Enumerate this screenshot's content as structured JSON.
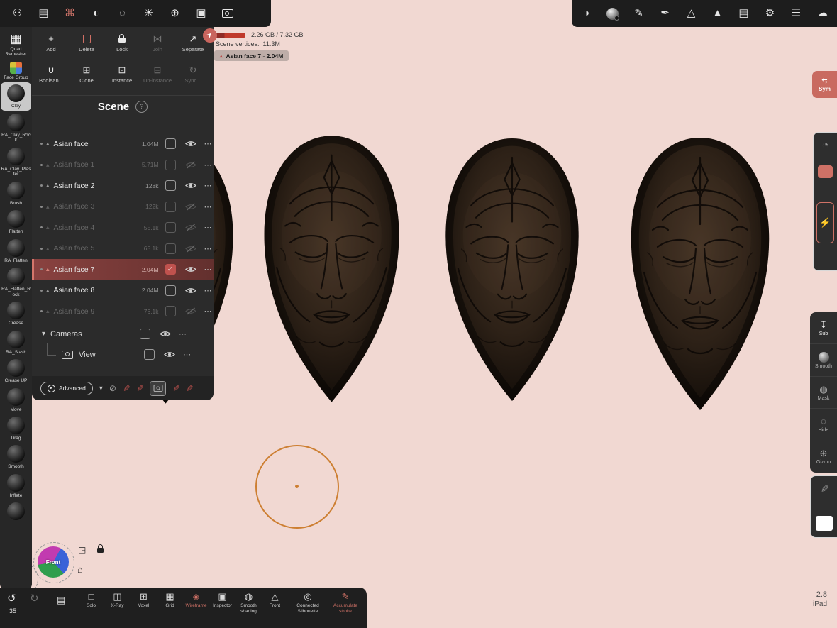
{
  "app": {
    "undo_count": "35",
    "version": "2.8",
    "device": "iPad"
  },
  "memory": {
    "usage": "2.26 GB / 7.32 GB",
    "vertices_label": "Scene vertices:",
    "vertices_value": "11.3M",
    "selected_chip": "Asian face 7 - 2.04M"
  },
  "glyphs": {
    "dots": "⋯",
    "triangle": "▴",
    "chevron": "▾",
    "help": "?",
    "undo": "↺",
    "redo": "↻",
    "list": "▤",
    "pin": "➤",
    "plus": "+",
    "join": "⋈",
    "separate": "↗",
    "boolean": "∪",
    "clone": "⊞",
    "instance": "⊡",
    "uninstance": "⊟",
    "sync": "↻",
    "adv_circle": "⊘",
    "brush": "✎",
    "dial": "◔",
    "bolt": "⚡",
    "sym": "⇆",
    "home": "⌂",
    "expand": "◳"
  },
  "top_toolbar": {
    "left_icons": [
      {
        "name": "users",
        "glyph": "⚇"
      },
      {
        "name": "files",
        "glyph": "▤"
      },
      {
        "name": "scene-graph",
        "glyph": "⌘"
      },
      {
        "name": "boolean",
        "glyph": "◐"
      },
      {
        "name": "topology",
        "glyph": "◌"
      },
      {
        "name": "lighting",
        "glyph": "☀"
      },
      {
        "name": "environment",
        "glyph": "⊕"
      },
      {
        "name": "image",
        "glyph": "▣"
      }
    ],
    "right_icons": [
      {
        "name": "paint",
        "glyph": "◑"
      },
      {
        "name": "pencil",
        "glyph": "✎"
      },
      {
        "name": "stamp",
        "glyph": "✒"
      },
      {
        "name": "falloff",
        "glyph": "△"
      },
      {
        "name": "alpha",
        "glyph": "▲"
      },
      {
        "name": "layers",
        "glyph": "▤"
      },
      {
        "name": "settings",
        "glyph": "⚙"
      },
      {
        "name": "sliders",
        "glyph": "☰"
      },
      {
        "name": "cloud",
        "glyph": "☁"
      }
    ]
  },
  "edit_toolbar": {
    "row1": [
      {
        "label": "Add"
      },
      {
        "label": "Delete"
      },
      {
        "label": "Lock"
      },
      {
        "label": "Join"
      },
      {
        "label": "Separate"
      }
    ],
    "row2": [
      {
        "label": "Boolean..."
      },
      {
        "label": "Clone"
      },
      {
        "label": "Instance"
      },
      {
        "label": "Un-instance"
      },
      {
        "label": "Sync..."
      }
    ]
  },
  "scene_panel": {
    "title": "Scene",
    "items": [
      {
        "name": "Asian face",
        "count": "1.04M",
        "visible": true,
        "selected": false,
        "checked": false
      },
      {
        "name": "Asian face 1",
        "count": "5.71M",
        "visible": false,
        "selected": false,
        "checked": false
      },
      {
        "name": "Asian face 2",
        "count": "128k",
        "visible": true,
        "selected": false,
        "checked": false
      },
      {
        "name": "Asian face 3",
        "count": "122k",
        "visible": false,
        "selected": false,
        "checked": false
      },
      {
        "name": "Asian face 4",
        "count": "55.1k",
        "visible": false,
        "selected": false,
        "checked": false
      },
      {
        "name": "Asian face 5",
        "count": "65.1k",
        "visible": false,
        "selected": false,
        "checked": false
      },
      {
        "name": "Asian face 7",
        "count": "2.04M",
        "visible": true,
        "selected": true,
        "checked": true
      },
      {
        "name": "Asian face 8",
        "count": "2.04M",
        "visible": true,
        "selected": false,
        "checked": false
      },
      {
        "name": "Asian face 9",
        "count": "76.1k",
        "visible": false,
        "selected": false,
        "checked": false
      }
    ],
    "cameras_label": "Cameras",
    "view_label": "View",
    "advanced_label": "Advanced"
  },
  "left_tools": {
    "items": [
      {
        "label": "Quad Remesher"
      },
      {
        "label": "Face Group"
      },
      {
        "label": "Clay",
        "selected": true
      },
      {
        "label": "RA_Clay_Rock"
      },
      {
        "label": "RA_Clay_Plaster"
      },
      {
        "label": "Brush"
      },
      {
        "label": "Flatten"
      },
      {
        "label": "RA_Flatten"
      },
      {
        "label": "RA_Flatten_Rock"
      },
      {
        "label": "Crease"
      },
      {
        "label": "RA_Slash"
      },
      {
        "label": "Crease UP"
      },
      {
        "label": "Move"
      },
      {
        "label": "Drag"
      },
      {
        "label": "Smooth"
      },
      {
        "label": "Inflate"
      }
    ]
  },
  "right_rail": {
    "sym_label": "Sym",
    "buttons": [
      {
        "label": "Sub",
        "glyph": "↧"
      },
      {
        "label": "Smooth",
        "glyph": ""
      },
      {
        "label": "Mask",
        "glyph": "◍"
      },
      {
        "label": "Hide",
        "glyph": "◌"
      },
      {
        "label": "Gizmo",
        "glyph": "⊕"
      }
    ]
  },
  "bottom_toolbar": {
    "items": [
      {
        "label": "Solo",
        "glyph": "□",
        "active": false
      },
      {
        "label": "X-Ray",
        "glyph": "◫",
        "active": false
      },
      {
        "label": "Voxel",
        "glyph": "⊞",
        "active": false
      },
      {
        "label": "Grid",
        "glyph": "▦",
        "active": false
      },
      {
        "label": "Wireframe",
        "glyph": "◈",
        "active": true
      },
      {
        "label": "Inspector",
        "glyph": "▣",
        "active": false
      },
      {
        "label": "Smooth shading",
        "glyph": "◍",
        "active": false
      },
      {
        "label": "Front",
        "glyph": "△",
        "active": false
      },
      {
        "label": "Connected Silhouette",
        "glyph": "◎",
        "active": false
      },
      {
        "label": "Accumulate stroke",
        "glyph": "✎",
        "active": true
      }
    ]
  },
  "nav": {
    "front_label": "Front"
  }
}
